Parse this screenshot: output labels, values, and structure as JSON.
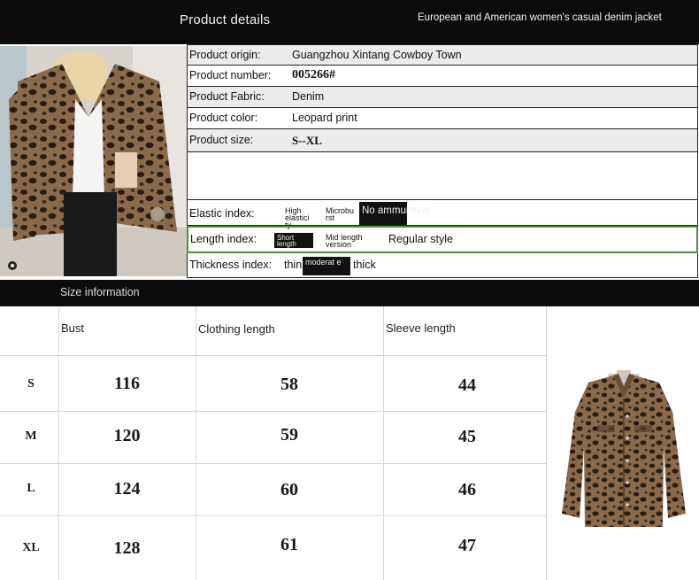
{
  "header": {
    "title": "Product details",
    "subtitle": "European and American women's casual denim jacket"
  },
  "details": {
    "origin_label": "Product origin:",
    "origin_value": "Guangzhou Xintang Cowboy Town",
    "number_label": "Product number:",
    "number_value": "005266#",
    "fabric_label": "Product Fabric:",
    "fabric_value": "Denim",
    "color_label": "Product color:",
    "color_value": "Leopard print",
    "size_label": "Product size:",
    "size_value": "S--XL",
    "elastic_label": "Elastic index:",
    "elastic_high": "High elastici ty",
    "elastic_micro": "Microbu rst",
    "elastic_none": "No ammunition",
    "length_label": "Length index:",
    "length_short": "Short length",
    "length_mid": "Mid length version",
    "length_regular": "Regular style",
    "thickness_label": "Thickness index:",
    "thickness_thin": "thin",
    "thickness_moderate": "moderat e",
    "thickness_thick": "thick"
  },
  "size_section": {
    "title": "Size information",
    "headers": [
      "Bust",
      "Clothing length",
      "Sleeve length"
    ],
    "rows": [
      {
        "size": "S",
        "bust": "116",
        "length": "58",
        "sleeve": "44"
      },
      {
        "size": "M",
        "bust": "120",
        "length": "59",
        "sleeve": "45"
      },
      {
        "size": "L",
        "bust": "124",
        "length": "60",
        "sleeve": "46"
      },
      {
        "size": "XL",
        "bust": "128",
        "length": "61",
        "sleeve": "47"
      }
    ]
  },
  "colors": {
    "bar": "#0b0b0b",
    "leopard_base": "#8a6a4a",
    "leopard_spot": "#2a1c12",
    "highlight_border": "#4f8f3f"
  }
}
